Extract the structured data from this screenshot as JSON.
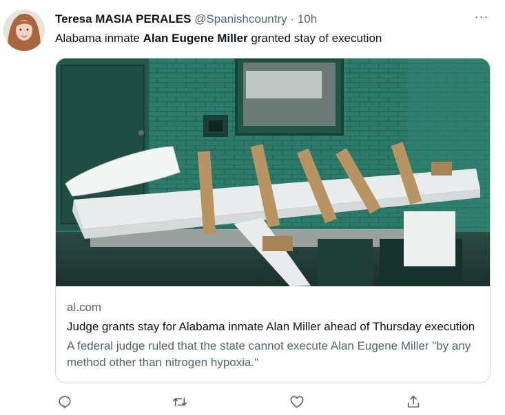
{
  "tweet": {
    "display_name": "Teresa MASIA PERALES",
    "handle": "@Spanishcountry",
    "separator": "·",
    "time": "10h",
    "more": "···",
    "text_before": "Alabama inmate ",
    "text_bold": "Alan Eugene Miller",
    "text_after": " granted stay of execution"
  },
  "card": {
    "domain": "al.com",
    "title": "Judge grants stay for Alabama inmate Alan Miller ahead of Thursday execution",
    "description": "A federal judge ruled that the state cannot execute Alan Eugene Miller \"by any method other than nitrogen hypoxia.\""
  },
  "actions": [
    {
      "name": "reply",
      "icon": "reply-icon"
    },
    {
      "name": "retweet",
      "icon": "retweet-icon"
    },
    {
      "name": "like",
      "icon": "heart-icon"
    },
    {
      "name": "share",
      "icon": "share-icon"
    }
  ],
  "colors": {
    "text_primary": "#0f1419",
    "text_secondary": "#536471",
    "border": "#cfd9de"
  }
}
